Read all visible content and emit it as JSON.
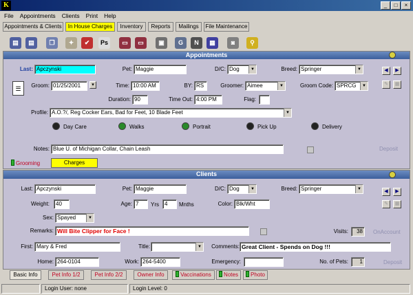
{
  "app": {
    "logo": "K"
  },
  "menu": [
    "File",
    "Appointments",
    "Clients",
    "Print",
    "Help"
  ],
  "tabs": [
    {
      "label": "Appointments & Clients"
    },
    {
      "label": "In House Charges"
    },
    {
      "label": "Inventory"
    },
    {
      "label": "Reports"
    },
    {
      "label": "Mailings"
    },
    {
      "label": "File Maintenance"
    }
  ],
  "toolbar": {
    "icons": [
      "print-icon",
      "print-alt-icon",
      "copy-icon",
      "wizard-icon",
      "check-icon",
      "ps-icon",
      "screen-icon",
      "screen2-icon",
      "folder-icon",
      "g-icon",
      "n-icon",
      "calendar-icon",
      "camera-icon",
      "search-icon"
    ]
  },
  "appointments": {
    "title": "Appointments",
    "last_label": "Last:",
    "last": "Apczynski",
    "pet_label": "Pet:",
    "pet": "Maggie",
    "dc_label": "D/C:",
    "dc": "Dog",
    "breed_label": "Breed:",
    "breed": "Springer",
    "groom_label": "Groom:",
    "groom_date": "01/25/2001",
    "time_label": "Time:",
    "time": "10:00 AM",
    "by_label": "BY:",
    "by": "RS",
    "groomer_label": "Groomer:",
    "groomer": "Aimee",
    "groom_code_label": "Groom Code:",
    "groom_code": "SPRCG",
    "duration_label": "Duration:",
    "duration": "90",
    "time_out_label": "Time Out:",
    "time_out": "4:00 PM",
    "flag_label": "Flag:",
    "flag": "",
    "profile_label": "Profile:",
    "profile": "A.O.?/,  Reg Cocker Ears, Bad for Feet, 10 Blade Feet",
    "radios": [
      "Day Care",
      "Walks",
      "Portrait",
      "Pick Up",
      "Delivery"
    ],
    "notes_label": "Notes:",
    "notes": "Blue U. of Michigan Collar, Chain Leash",
    "deposit": "Deposit",
    "sub_tabs": [
      "Grooming",
      "Charges"
    ]
  },
  "clients": {
    "title": "Clients",
    "last_label": "Last:",
    "last": "Apczynski",
    "pet_label": "Pet:",
    "pet": "Maggie",
    "dc_label": "D/C:",
    "dc": "Dog",
    "breed_label": "Breed:",
    "breed": "Springer",
    "weight_label": "Weight:",
    "weight": "40",
    "age_label": "Age:",
    "age_yrs": "7",
    "yrs_label": "Yrs",
    "age_mnths": "4",
    "mnths_label": "Mnths",
    "color_label": "Color:",
    "color": "Blk/Wht",
    "sex_label": "Sex:",
    "sex": "Spayed",
    "remarks_label": "Remarks:",
    "remarks": "Will Bite Clipper for Face !",
    "visits_label": "Visits:",
    "visits": "38",
    "on_account": "OnAccount",
    "first_label": "First:",
    "first": "Mary & Fred",
    "title_label": "Title:",
    "title_val": "",
    "comments_label": "Comments:",
    "comments": "Great Client - Spends on Dog !!!",
    "home_label": "Home:",
    "home": "264-0104",
    "work_label": "Work:",
    "work": "264-5400",
    "emergency_label": "Emergency:",
    "emergency": "",
    "num_pets_label": "No. of Pets:",
    "num_pets": "1",
    "deposit": "Deposit"
  },
  "bottom_tabs": [
    "Basic Info",
    "Pet Info 1/2",
    "Pet Info 2/2",
    "Owner Info",
    "Vaccinations",
    "Notes",
    "Photo"
  ],
  "status": {
    "user": "Login User: none",
    "level": "Login Level: 0"
  }
}
